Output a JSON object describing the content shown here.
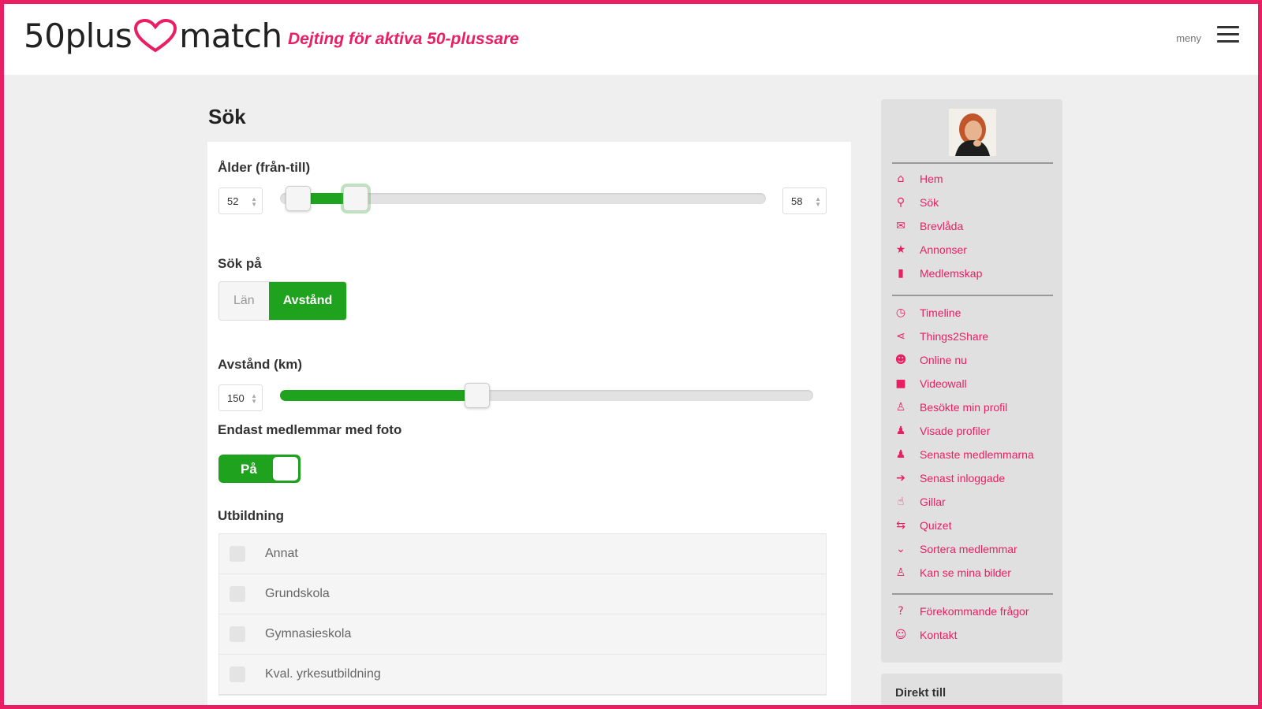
{
  "header": {
    "logo_left": "50plus",
    "logo_right": "match",
    "tagline": "Dejting för aktiva 50-plussare",
    "menu_label": "meny"
  },
  "colors": {
    "brand": "#e91e63",
    "accent_green": "#1fa31f"
  },
  "main": {
    "title": "Sök",
    "age": {
      "label": "Ålder (från-till)",
      "from_value": "52",
      "to_value": "58",
      "range_min": 50,
      "range_max": 120
    },
    "search_on": {
      "label": "Sök på",
      "options": [
        "Län",
        "Avstånd"
      ],
      "selected": "Avstånd"
    },
    "distance": {
      "label": "Avstånd (km)",
      "value": "150",
      "slider_fraction": 0.37
    },
    "photo_only": {
      "label": "Endast medlemmar med foto",
      "toggle_label": "På",
      "state": "on"
    },
    "education": {
      "label": "Utbildning",
      "items": [
        "Annat",
        "Grundskola",
        "Gymnasieskola",
        "Kval. yrkesutbildning"
      ]
    }
  },
  "sidebar": {
    "group1": [
      {
        "icon": "home-icon",
        "label": "Hem"
      },
      {
        "icon": "search-icon",
        "label": "Sök"
      },
      {
        "icon": "envelope-icon",
        "label": "Brevlåda"
      },
      {
        "icon": "ad-icon",
        "label": "Annonser"
      },
      {
        "icon": "membership-icon",
        "label": "Medlemskap"
      }
    ],
    "group2": [
      {
        "icon": "clock-icon",
        "label": "Timeline"
      },
      {
        "icon": "share-icon",
        "label": "Things2Share"
      },
      {
        "icon": "users-icon",
        "label": "Online nu"
      },
      {
        "icon": "video-icon",
        "label": "Videowall"
      },
      {
        "icon": "visitor-icon",
        "label": "Besökte min profil"
      },
      {
        "icon": "user-icon",
        "label": "Visade profiler"
      },
      {
        "icon": "user-plus-icon",
        "label": "Senaste medlemmarna"
      },
      {
        "icon": "sign-in-icon",
        "label": "Senast inloggade"
      },
      {
        "icon": "thumbs-up-icon",
        "label": "Gillar"
      },
      {
        "icon": "retweet-icon",
        "label": "Quizet"
      },
      {
        "icon": "chevron-down-icon",
        "label": "Sortera medlemmar"
      },
      {
        "icon": "photo-access-icon",
        "label": "Kan se mina bilder"
      }
    ],
    "group3": [
      {
        "icon": "question-icon",
        "label": "Förekommande frågor"
      },
      {
        "icon": "support-icon",
        "label": "Kontakt"
      }
    ],
    "bottom_panel_title": "Direkt till"
  }
}
